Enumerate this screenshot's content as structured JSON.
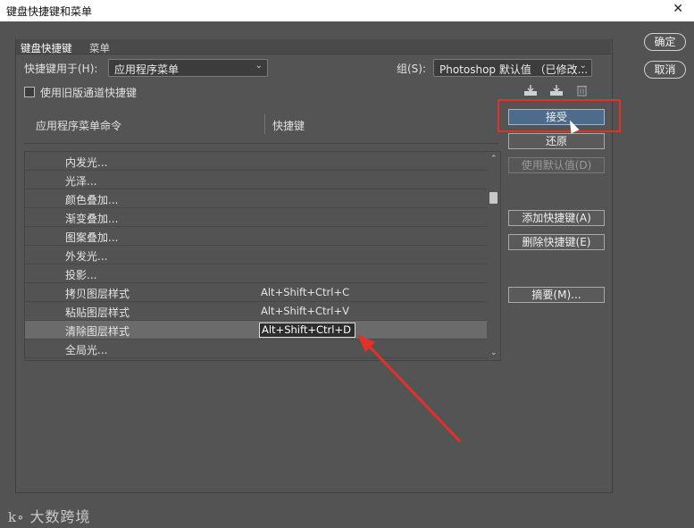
{
  "window": {
    "title": "键盘快捷键和菜单",
    "close_glyph": "✕"
  },
  "tabs": [
    {
      "label": "键盘快捷键",
      "active": true
    },
    {
      "label": "菜单",
      "active": false
    }
  ],
  "shortcuts_for": {
    "label": "快捷键用于(H):",
    "value": "应用程序菜单"
  },
  "set": {
    "label": "组(S):",
    "value": "Photoshop 默认值 （已修改..."
  },
  "legacy_checkbox": {
    "label": "使用旧版通道快捷键",
    "checked": false
  },
  "icons": {
    "save_set": "save-set-icon",
    "new_set": "new-set-icon",
    "delete_set": "trash-icon"
  },
  "columns": {
    "command": "应用程序菜单命令",
    "shortcut": "快捷键"
  },
  "rows": [
    {
      "name": "内发光...",
      "key": ""
    },
    {
      "name": "光泽...",
      "key": ""
    },
    {
      "name": "颜色叠加...",
      "key": ""
    },
    {
      "name": "渐变叠加...",
      "key": ""
    },
    {
      "name": "图案叠加...",
      "key": ""
    },
    {
      "name": "外发光...",
      "key": ""
    },
    {
      "name": "投影...",
      "key": ""
    },
    {
      "name": "拷贝图层样式",
      "key": "Alt+Shift+Ctrl+C"
    },
    {
      "name": "粘贴图层样式",
      "key": "Alt+Shift+Ctrl+V"
    },
    {
      "name": "清除图层样式",
      "key": "Alt+Shift+Ctrl+D",
      "selected": true
    },
    {
      "name": "全局光...",
      "key": ""
    }
  ],
  "actions": {
    "accept": "接受",
    "undo": "还原",
    "use_default": "使用默认值(D)",
    "add_shortcut": "添加快捷键(A)",
    "delete_shortcut": "删除快捷键(E)",
    "summarize": "摘要(M)..."
  },
  "dialog_buttons": {
    "ok": "确定",
    "cancel": "取消"
  },
  "watermark": "大数跨境",
  "colors": {
    "annotation_red": "#e5302a",
    "accept_blue": "#4d6b8a"
  }
}
